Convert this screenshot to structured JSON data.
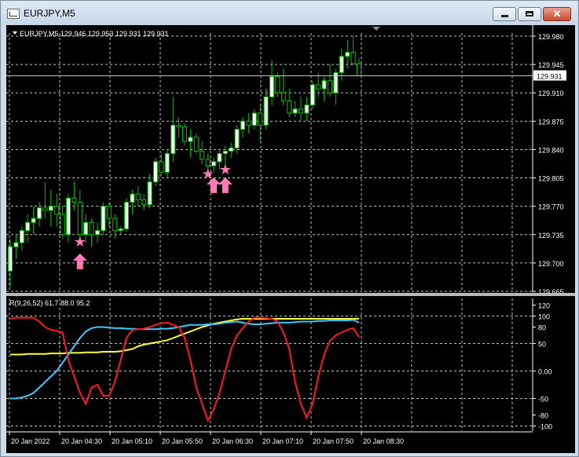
{
  "window": {
    "title": "EURJPY,M5",
    "buttons": {
      "minimize": "",
      "maximize": "",
      "close": "✕"
    }
  },
  "chart": {
    "header": "EURJPY,M5  129.946 129.953 129.931 129.931",
    "price_labels": [
      "129.980",
      "129.945",
      "129.910",
      "129.875",
      "129.840",
      "129.805",
      "129.770",
      "129.735",
      "129.700",
      "129.665"
    ],
    "current_price": "129.931",
    "time_labels": [
      "20 Jan 2022",
      "20 Jan 04:30",
      "20 Jan 05:10",
      "20 Jan 05:50",
      "20 Jan 06:30",
      "20 Jan 07:10",
      "20 Jan 07:50",
      "20 Jan 08:30"
    ],
    "colors": {
      "background": "#000000",
      "grid": "#c0c0c0",
      "bull_body": "#f0fff0",
      "bear_body": "#000000",
      "candle_line": "#00c000",
      "arrow": "#ff7ab6",
      "current_line": "#c0c0c0"
    }
  },
  "indicator": {
    "header": "R(9,26,52) 61.7 88.0 95.2",
    "levels": [
      "120",
      "100",
      "80",
      "50",
      "0.00",
      "-50",
      "-80",
      "-100"
    ],
    "colors": {
      "red": "#ff1a1a",
      "cyan": "#40c8ff",
      "yellow": "#ffff33"
    }
  },
  "chart_data": [
    {
      "type": "candlestick",
      "symbol": "EURJPY",
      "timeframe": "M5",
      "ylim": [
        129.665,
        129.98
      ],
      "y_ticks": [
        129.98,
        129.945,
        129.91,
        129.875,
        129.84,
        129.805,
        129.77,
        129.735,
        129.7,
        129.665
      ],
      "last": {
        "open": 129.946,
        "high": 129.953,
        "low": 129.931,
        "close": 129.931
      },
      "candles": [
        [
          129.69,
          129.73,
          129.67,
          129.72
        ],
        [
          129.72,
          129.735,
          129.705,
          129.725
        ],
        [
          129.725,
          129.745,
          129.715,
          129.74
        ],
        [
          129.74,
          129.76,
          129.725,
          129.75
        ],
        [
          129.75,
          129.77,
          129.735,
          129.755
        ],
        [
          129.755,
          129.775,
          129.745,
          129.768
        ],
        [
          129.768,
          129.8,
          129.755,
          129.765
        ],
        [
          129.765,
          129.79,
          129.745,
          129.77
        ],
        [
          129.77,
          129.785,
          129.745,
          129.76
        ],
        [
          129.76,
          129.77,
          129.73,
          129.735
        ],
        [
          129.735,
          129.785,
          129.725,
          129.78
        ],
        [
          129.78,
          129.8,
          129.765,
          129.775
        ],
        [
          129.775,
          129.79,
          129.725,
          129.735
        ],
        [
          129.735,
          129.76,
          129.725,
          129.75
        ],
        [
          129.75,
          129.755,
          129.72,
          129.735
        ],
        [
          129.735,
          129.75,
          129.725,
          129.74
        ],
        [
          129.74,
          129.775,
          129.735,
          129.77
        ],
        [
          129.77,
          129.775,
          129.745,
          129.755
        ],
        [
          129.755,
          129.76,
          129.73,
          129.74
        ],
        [
          129.74,
          129.745,
          129.735,
          129.742
        ],
        [
          129.742,
          129.78,
          129.738,
          129.775
        ],
        [
          129.775,
          129.79,
          129.76,
          129.785
        ],
        [
          129.785,
          129.795,
          129.77,
          129.778
        ],
        [
          129.778,
          129.785,
          129.765,
          129.772
        ],
        [
          129.772,
          129.81,
          129.768,
          129.8
        ],
        [
          129.8,
          129.83,
          129.795,
          129.825
        ],
        [
          129.825,
          129.835,
          129.808,
          129.812
        ],
        [
          129.812,
          129.84,
          129.805,
          129.835
        ],
        [
          129.835,
          129.905,
          129.825,
          129.87
        ],
        [
          129.87,
          129.88,
          129.855,
          129.868
        ],
        [
          129.868,
          129.872,
          129.845,
          129.85
        ],
        [
          129.85,
          129.865,
          129.83,
          129.855
        ],
        [
          129.855,
          129.86,
          129.835,
          129.838
        ],
        [
          129.838,
          129.85,
          129.822,
          129.828
        ],
        [
          129.828,
          129.835,
          129.815,
          129.82
        ],
        [
          129.82,
          129.83,
          129.812,
          129.825
        ],
        [
          129.825,
          129.84,
          129.815,
          129.835
        ],
        [
          129.835,
          129.845,
          129.82,
          129.838
        ],
        [
          129.838,
          129.848,
          129.83,
          129.842
        ],
        [
          129.842,
          129.87,
          129.835,
          129.865
        ],
        [
          129.865,
          129.88,
          129.855,
          129.875
        ],
        [
          129.875,
          129.885,
          129.86,
          129.87
        ],
        [
          129.87,
          129.89,
          129.865,
          129.885
        ],
        [
          129.885,
          129.895,
          129.85,
          129.87
        ],
        [
          129.87,
          129.915,
          129.865,
          129.905
        ],
        [
          129.905,
          129.95,
          129.895,
          129.93
        ],
        [
          129.93,
          129.935,
          129.905,
          129.91
        ],
        [
          129.91,
          129.94,
          129.895,
          129.9
        ],
        [
          129.9,
          129.915,
          129.88,
          129.885
        ],
        [
          129.885,
          129.9,
          129.88,
          129.89
        ],
        [
          129.89,
          129.905,
          129.875,
          129.885
        ],
        [
          129.885,
          129.905,
          129.875,
          129.895
        ],
        [
          129.895,
          129.925,
          129.89,
          129.92
        ],
        [
          129.92,
          129.935,
          129.905,
          129.915
        ],
        [
          129.915,
          129.93,
          129.9,
          129.925
        ],
        [
          129.925,
          129.945,
          129.905,
          129.91
        ],
        [
          129.91,
          129.94,
          129.895,
          129.935
        ],
        [
          129.935,
          129.965,
          129.925,
          129.955
        ],
        [
          129.955,
          129.975,
          129.94,
          129.96
        ],
        [
          129.96,
          129.98,
          129.945,
          129.946
        ],
        [
          129.946,
          129.953,
          129.931,
          129.931
        ]
      ],
      "signals": [
        {
          "type": "star",
          "candle": 12,
          "price": 129.726
        },
        {
          "type": "arrow-up",
          "candle": 12,
          "price": 129.702
        },
        {
          "type": "star",
          "candle": 34,
          "price": 129.81
        },
        {
          "type": "star",
          "candle": 37,
          "price": 129.815
        },
        {
          "type": "arrow-up",
          "candle": 35,
          "price": 129.796
        },
        {
          "type": "arrow-up",
          "candle": 37,
          "price": 129.796
        }
      ]
    },
    {
      "type": "line",
      "title": "R(9,26,52)",
      "ylim": [
        -105,
        125
      ],
      "y_ticks": [
        120,
        100,
        80,
        50,
        0,
        -50,
        -80,
        -100
      ],
      "series": [
        {
          "name": "red",
          "values": [
            95,
            97,
            97,
            97,
            97,
            90,
            80,
            75,
            73,
            70,
            20,
            -10,
            -40,
            -60,
            -30,
            -25,
            -45,
            -45,
            -20,
            20,
            60,
            75,
            76,
            77,
            80,
            84,
            87,
            88,
            84,
            80,
            60,
            20,
            -30,
            -60,
            -90,
            -70,
            -40,
            0,
            40,
            65,
            78,
            90,
            97,
            97,
            96,
            95,
            90,
            70,
            40,
            -20,
            -60,
            -85,
            -60,
            -10,
            30,
            55,
            65,
            70,
            75,
            78,
            61.7
          ]
        },
        {
          "name": "cyan",
          "values": [
            -50,
            -50,
            -48,
            -45,
            -40,
            -30,
            -20,
            -10,
            0,
            15,
            30,
            45,
            60,
            72,
            78,
            80,
            80,
            79,
            78,
            78,
            77,
            77,
            76,
            76,
            76,
            76,
            77,
            77,
            78,
            80,
            82,
            84,
            84,
            84,
            85,
            85,
            86,
            88,
            89,
            90,
            88,
            86,
            85,
            85,
            86,
            87,
            88,
            88,
            88,
            89,
            90,
            90,
            90,
            91,
            91,
            92,
            92,
            92,
            92,
            93,
            88
          ]
        },
        {
          "name": "yellow",
          "values": [
            30,
            30,
            30,
            31,
            31,
            31,
            31,
            32,
            32,
            32,
            33,
            33,
            33,
            34,
            34,
            34,
            35,
            35,
            35,
            36,
            38,
            40,
            45,
            48,
            50,
            52,
            54,
            56,
            60,
            64,
            68,
            72,
            76,
            80,
            83,
            86,
            88,
            90,
            92,
            94,
            95,
            95,
            95,
            95,
            95,
            95,
            95,
            95,
            95,
            95,
            95,
            95,
            95,
            95,
            95,
            95,
            95,
            95,
            95,
            95,
            95.2
          ]
        }
      ]
    }
  ]
}
